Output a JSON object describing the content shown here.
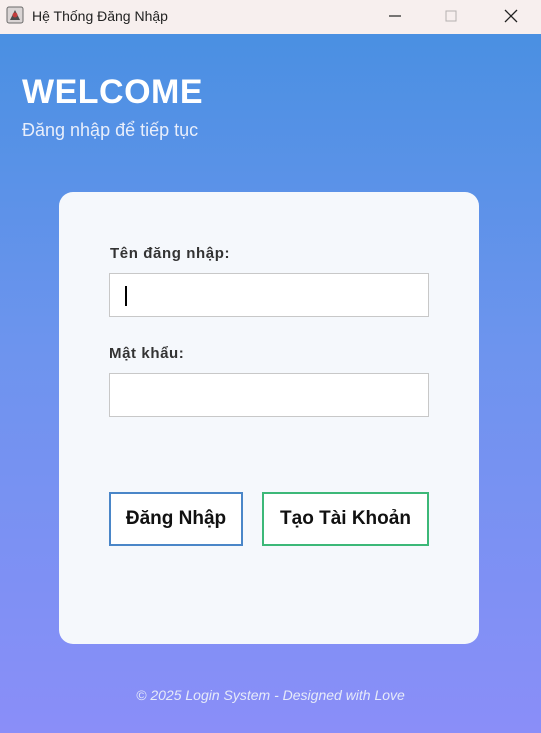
{
  "window": {
    "title": "Hệ Thống Đăng Nhập",
    "app_icon": "java-app-icon",
    "controls": {
      "minimize": "minimize-icon",
      "maximize": "maximize-icon",
      "close": "close-icon"
    }
  },
  "header": {
    "welcome": "WELCOME",
    "subtitle": "Đăng nhập để tiếp tục"
  },
  "form": {
    "username_label": "Tên đăng nhập:",
    "username_value": "",
    "password_label": "Mật khẩu:",
    "password_value": "",
    "login_button": "Đăng Nhập",
    "register_button": "Tạo Tài Khoản"
  },
  "footer": {
    "text": "© 2025 Login System - Designed with Love"
  },
  "colors": {
    "gradient_top": "#4a90e2",
    "gradient_bottom": "#8a8ef8",
    "login_border": "#4a86c8",
    "register_border": "#3cb878"
  }
}
